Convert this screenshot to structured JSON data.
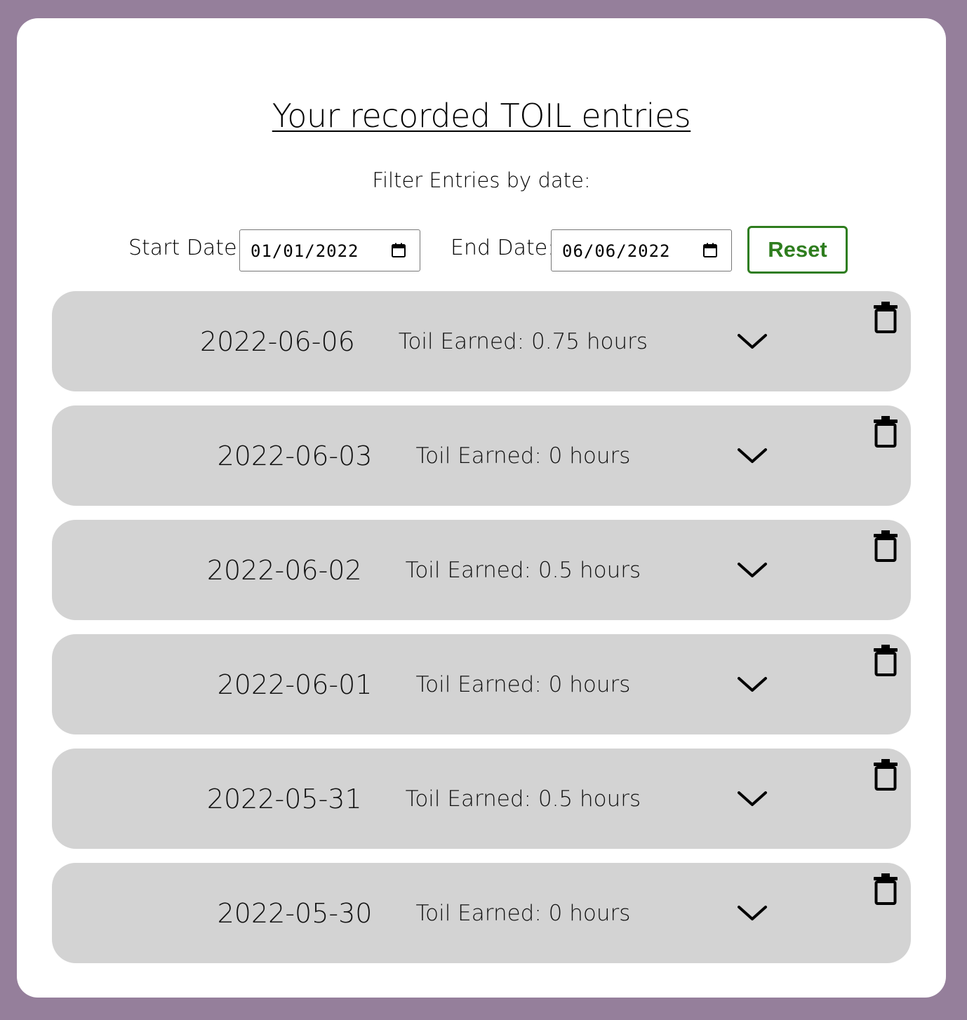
{
  "page": {
    "title": "Your recorded TOIL entries"
  },
  "filter": {
    "label": "Filter Entries by date:",
    "start_label": "Start Date:",
    "start_value": "01/01/2022",
    "end_label": "End Date:",
    "end_value": "06/06/2022",
    "reset_label": "Reset"
  },
  "icons": {
    "calendar": "calendar-icon",
    "expand": "chevron-down-icon",
    "delete": "trash-icon"
  },
  "colors": {
    "background": "#957f9b",
    "card": "#ffffff",
    "entry": "#d3d3d3",
    "reset_accent": "#2e7d1e"
  },
  "entries": [
    {
      "date": "2022-06-06",
      "toil": "Toil Earned: 0.75 hours"
    },
    {
      "date": "2022-06-03",
      "toil": "Toil Earned: 0 hours"
    },
    {
      "date": "2022-06-02",
      "toil": "Toil Earned: 0.5 hours"
    },
    {
      "date": "2022-06-01",
      "toil": "Toil Earned: 0 hours"
    },
    {
      "date": "2022-05-31",
      "toil": "Toil Earned: 0.5 hours"
    },
    {
      "date": "2022-05-30",
      "toil": "Toil Earned: 0 hours"
    }
  ]
}
